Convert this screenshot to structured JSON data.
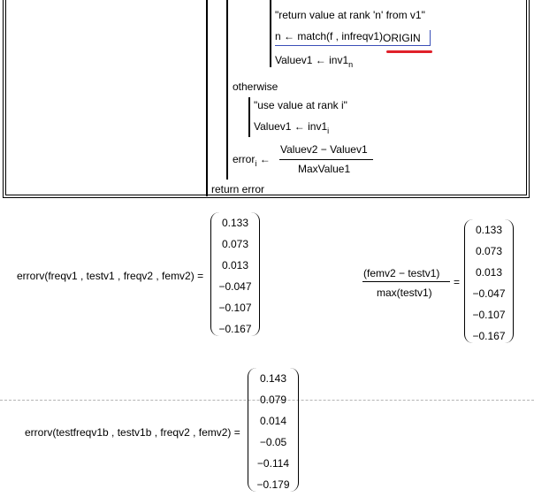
{
  "program": {
    "comment_return": "\"return value at rank 'n' from v1\"",
    "match_prefix": "n ← match(f , infreqv1)",
    "match_origin": "ORIGIN",
    "value1_assign": "Valuev1 ← inv1",
    "value1_sub": "n",
    "otherwise": "otherwise",
    "comment_use": "\"use value at rank i\"",
    "value1_assign2": "Valuev1 ← inv1",
    "value1_sub2": "i",
    "error_lhs": "error",
    "error_sub": "i",
    "error_arrow": "←",
    "error_num": "Valuev2 − Valuev1",
    "error_den": "MaxValue1",
    "return_line": "return  error"
  },
  "eval1": {
    "expr": "errorv(freqv1 , testv1 , freqv2 , femv2) =",
    "values": [
      "0.133",
      "0.073",
      "0.013",
      "−0.047",
      "−0.107",
      "−0.167"
    ]
  },
  "eval2": {
    "num": "(femv2 − testv1)",
    "den": "max(testv1)",
    "eq": "=",
    "values": [
      "0.133",
      "0.073",
      "0.013",
      "−0.047",
      "−0.107",
      "−0.167"
    ]
  },
  "eval3": {
    "expr": "errorv(testfreqv1b , testv1b , freqv2 , femv2) =",
    "values": [
      "0.143",
      "0.079",
      "0.014",
      "−0.05",
      "−0.114",
      "−0.179"
    ]
  },
  "colors": {
    "underline_red": "#e0202a",
    "selection_blue": "#3a4fb8"
  }
}
